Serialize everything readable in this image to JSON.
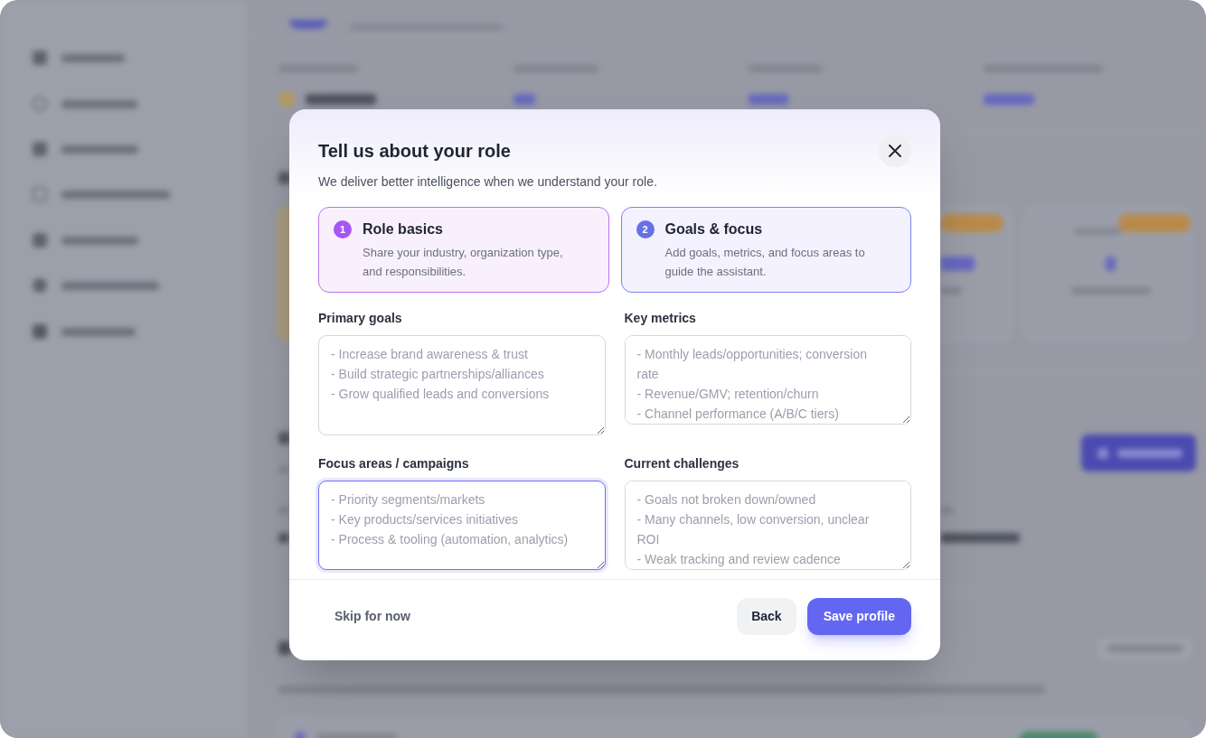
{
  "dialog": {
    "title": "Tell us about your role",
    "subtitle": "We deliver better intelligence when we understand your role."
  },
  "steps": [
    {
      "number": "1",
      "title": "Role basics",
      "description": "Share your industry, organization type, and responsibilities.",
      "completed": true,
      "selected": false
    },
    {
      "number": "2",
      "title": "Goals & focus",
      "description": "Add goals, metrics, and focus areas to guide the assistant.",
      "completed": false,
      "selected": true
    }
  ],
  "fields": [
    {
      "label": "Primary goals",
      "placeholder": "- Increase brand awareness & trust\n- Build strategic partnerships/alliances\n- Grow qualified leads and conversions",
      "focused": false
    },
    {
      "label": "Key metrics",
      "placeholder": "- Monthly leads/opportunities; conversion rate\n- Revenue/GMV; retention/churn\n- Channel performance (A/B/C tiers)",
      "focused": false
    },
    {
      "label": "Focus areas / campaigns",
      "placeholder": "- Priority segments/markets\n- Key products/services initiatives\n- Process & tooling (automation, analytics)",
      "focused": true
    },
    {
      "label": "Current challenges",
      "placeholder": "- Goals not broken down/owned\n- Many channels, low conversion, unclear ROI\n- Weak tracking and review cadence",
      "focused": false
    }
  ],
  "footer": {
    "skip": "Skip for now",
    "buttons": [
      {
        "label": "Back",
        "kind": "secondary"
      },
      {
        "label": "Save profile",
        "kind": "primary"
      }
    ]
  }
}
